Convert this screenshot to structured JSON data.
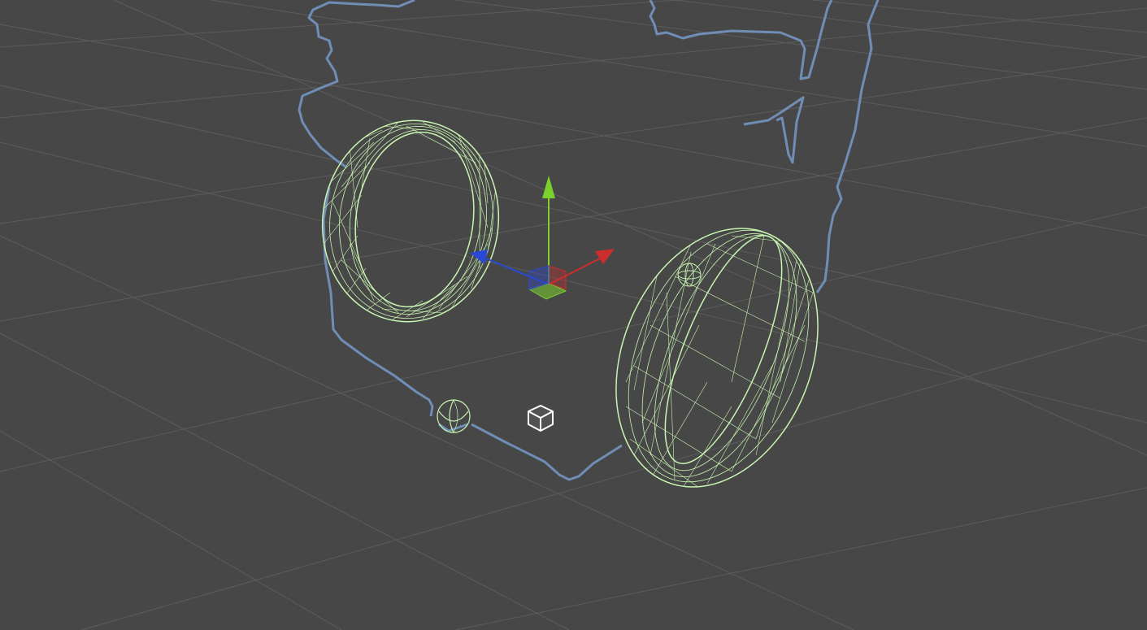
{
  "viewport": {
    "background": "#474747",
    "grid_color": "#5c5c5c",
    "selection_outline_color": "#6f8db5",
    "collider_wire_color": "#c8f5b0"
  },
  "gizmo": {
    "type": "move-transform-gizmo",
    "x_axis_color": "#cc2d2d",
    "y_axis_color": "#7bd02d",
    "z_axis_color": "#2a48d6"
  },
  "objects": [
    {
      "name": "left-wheel",
      "kind": "mesh-collider-wireframe"
    },
    {
      "name": "right-wheel",
      "kind": "mesh-collider-wireframe"
    },
    {
      "name": "caster-sphere",
      "kind": "sphere-collider-wireframe"
    },
    {
      "name": "small-sphere",
      "kind": "sphere-collider-wireframe"
    }
  ],
  "icons": {
    "object_icon": "cube-icon"
  }
}
